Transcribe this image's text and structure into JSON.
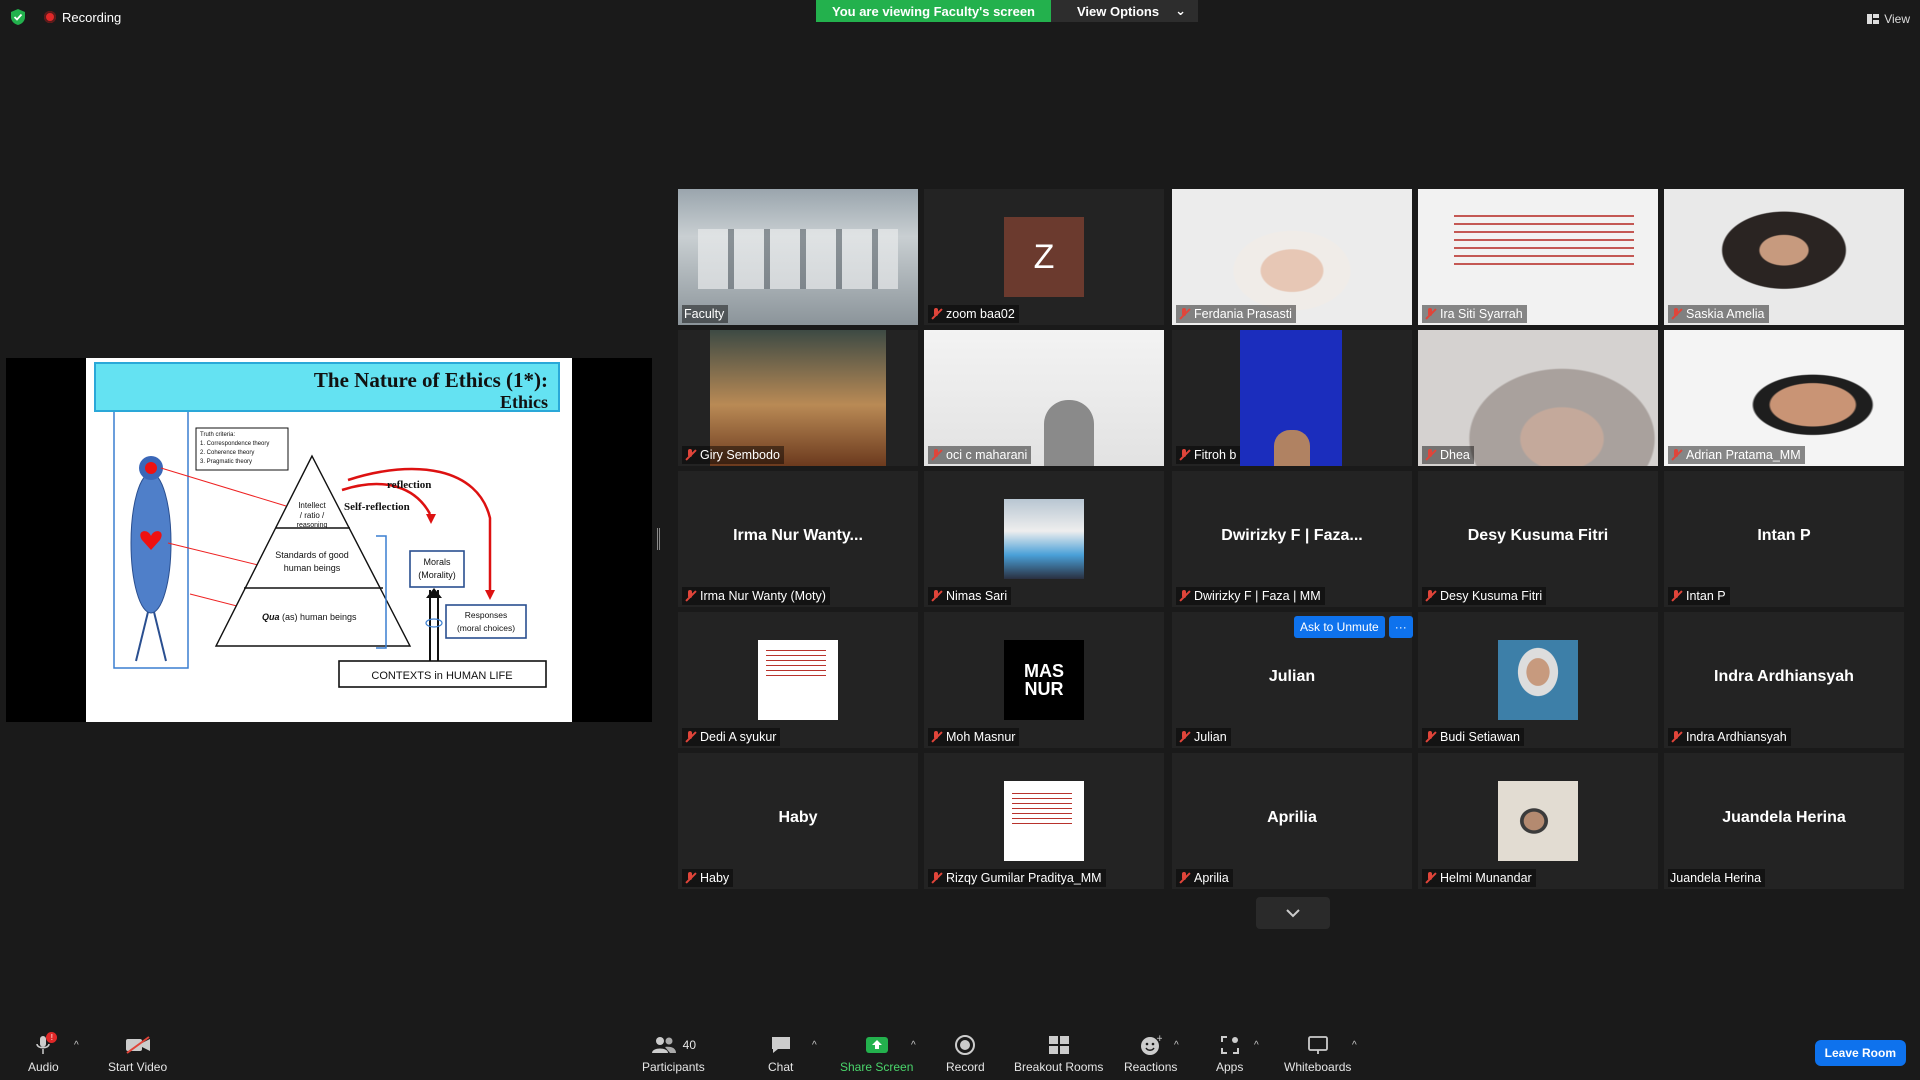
{
  "top": {
    "recording": "Recording",
    "viewing_banner": "You are viewing Faculty's screen",
    "view_options": "View Options",
    "view": "View"
  },
  "slide": {
    "title": "The Nature of Ethics (1*):",
    "subtitle": "Ethics",
    "truth_criteria_heading": "Truth criteria:",
    "truth_criteria": [
      "1. Correspondence theory",
      "2. Coherence theory",
      "3. Pragmatic theory"
    ],
    "pyramid_top": [
      "Intellect",
      "/ ratio /",
      "reasoning"
    ],
    "pyramid_mid": [
      "Standards of good",
      "human beings"
    ],
    "pyramid_bottom_qua": "Qua",
    "pyramid_bottom_rest": " (as) human beings",
    "reflection": "reflection",
    "self_reflection": "Self-reflection",
    "morals": [
      "Morals",
      "(Morality)"
    ],
    "responses": [
      "Responses",
      "(moral choices)"
    ],
    "contexts": "CONTEXTS in HUMAN LIFE"
  },
  "participants": [
    {
      "name": "Faculty",
      "muted": false
    },
    {
      "name": "zoom baa02",
      "muted": true,
      "initial": "Z"
    },
    {
      "name": "Ferdania Prasasti",
      "muted": true
    },
    {
      "name": "Ira Siti Syarrah",
      "muted": true
    },
    {
      "name": "Saskia Amelia",
      "muted": true
    },
    {
      "name": "Giry Sembodo",
      "muted": true
    },
    {
      "name": "oci c maharani",
      "muted": true
    },
    {
      "name": "Fitroh b",
      "muted": true
    },
    {
      "name": "Dhea",
      "muted": true
    },
    {
      "name": "Adrian Pratama_MM",
      "muted": true
    },
    {
      "name": "Irma Nur Wanty (Moty)",
      "muted": true,
      "display": "Irma Nur Wanty..."
    },
    {
      "name": "Nimas Sari",
      "muted": true
    },
    {
      "name": "Dwirizky F | Faza | MM",
      "muted": true,
      "display": "Dwirizky F | Faza..."
    },
    {
      "name": "Desy Kusuma Fitri",
      "muted": true,
      "display": "Desy Kusuma Fitri"
    },
    {
      "name": "Intan P",
      "muted": true,
      "display": "Intan P"
    },
    {
      "name": "Dedi A syukur",
      "muted": true
    },
    {
      "name": "Moh Masnur",
      "muted": true,
      "logo": "MAS NUR"
    },
    {
      "name": "Julian",
      "muted": true,
      "display": "Julian"
    },
    {
      "name": "Budi Setiawan",
      "muted": true
    },
    {
      "name": "Indra Ardhiansyah",
      "muted": true,
      "display": "Indra Ardhiansyah"
    },
    {
      "name": "Haby",
      "muted": true,
      "display": "Haby"
    },
    {
      "name": "Rizqy Gumilar Praditya_MM",
      "muted": true
    },
    {
      "name": "Aprilia",
      "muted": true,
      "display": "Aprilia"
    },
    {
      "name": "Helmi Munandar",
      "muted": true
    },
    {
      "name": "Juandela Herina",
      "muted": false,
      "display": "Juandela Herina"
    }
  ],
  "ask_to_unmute": "Ask to Unmute",
  "more_dots": "···",
  "toolbar": {
    "audio": "Audio",
    "start_video": "Start Video",
    "participants": "Participants",
    "participants_count": "40",
    "chat": "Chat",
    "share_screen": "Share Screen",
    "record": "Record",
    "breakout_rooms": "Breakout Rooms",
    "reactions": "Reactions",
    "apps": "Apps",
    "whiteboards": "Whiteboards",
    "leave": "Leave Room",
    "audio_badge": "!"
  },
  "colors": {
    "green": "#23b14d",
    "blue": "#0e72ed",
    "red": "#e02828",
    "active": "#c8e23c"
  }
}
